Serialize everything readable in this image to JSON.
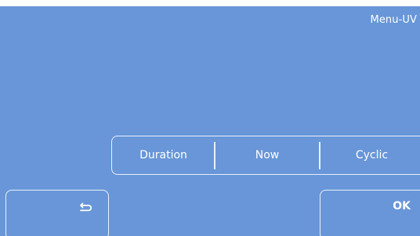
{
  "header": {
    "title": "Menu-UV"
  },
  "mode_selector": {
    "options": [
      "Duration",
      "Now",
      "Cyclic"
    ]
  },
  "footer": {
    "back_icon": "back-return-icon",
    "ok_label": "OK"
  },
  "colors": {
    "background": "#6896d8",
    "border": "#e9f1fb",
    "text": "#ffffff"
  }
}
